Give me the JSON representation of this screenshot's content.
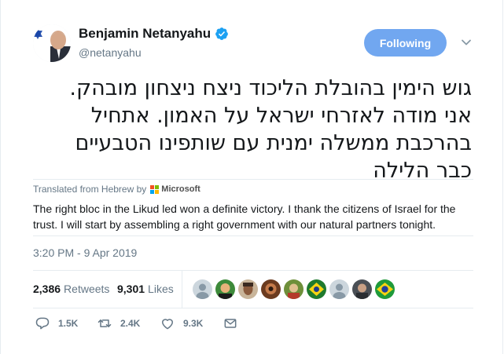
{
  "author": {
    "name": "Benjamin Netanyahu",
    "handle": "@netanyahu",
    "verified": true
  },
  "follow_button": {
    "label": "Following",
    "color": "#71a7f0"
  },
  "tweet": {
    "lines": [
      "גוש הימין בהובלת הליכוד ניצח ניצחון מובהק.",
      "אני מודה לאזרחי ישראל על האמון. אתחיל",
      "בהרכבת ממשלה ימנית עם שותפינו הטבעיים",
      "כבר הלילה"
    ]
  },
  "translation": {
    "attribution": "Translated from Hebrew by",
    "provider": "Microsoft",
    "text": "The right bloc in the Likud led won a definite victory. I thank the citizens of Israel for the trust. I will start by assembling a right government with our natural partners tonight."
  },
  "timestamp": "3:20 PM - 9 Apr 2019",
  "stats": {
    "retweets_count": "2,386",
    "retweets_label": "Retweets",
    "likes_count": "9,301",
    "likes_label": "Likes"
  },
  "likers": [
    "default-avatar",
    "photo-avatar",
    "photo-avatar",
    "photo-avatar",
    "photo-avatar",
    "flag-avatar",
    "default-avatar",
    "photo-avatar",
    "brazil-flag-avatar"
  ],
  "actions": {
    "replies": "1.5K",
    "retweets": "2.4K",
    "likes": "9.3K"
  },
  "colors": {
    "accent": "#1da1f2",
    "muted": "#657786",
    "border": "#e6ecf0"
  }
}
